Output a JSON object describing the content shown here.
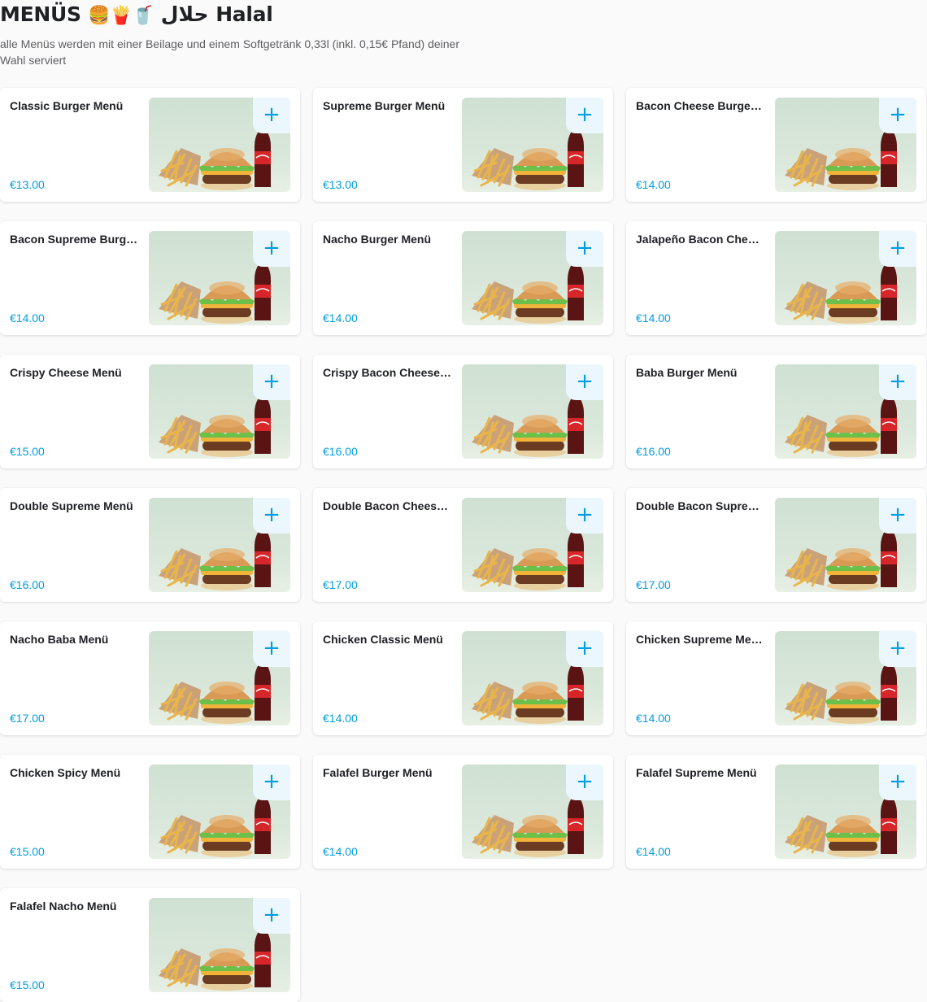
{
  "section": {
    "title": "MENÜS",
    "emoji": "🍔🍟🥤",
    "title_suffix": "حلال Halal",
    "description": "alle Menüs werden mit einer Beilage und einem Softgetränk 0,33l (inkl. 0,15€ Pfand) deiner Wahl serviert"
  },
  "add_label": "+",
  "colors": {
    "accent": "#009de0",
    "add_bg": "#ebf7fd",
    "image_bg": "#d4e5d7"
  },
  "items": [
    {
      "name": "Classic Burger Menü",
      "price": "€13.00"
    },
    {
      "name": "Supreme Burger Menü",
      "price": "€13.00"
    },
    {
      "name": "Bacon Cheese Burger Menü",
      "price": "€14.00"
    },
    {
      "name": "Bacon Supreme Burger Menü",
      "price": "€14.00"
    },
    {
      "name": "Nacho Burger Menü",
      "price": "€14.00"
    },
    {
      "name": "Jalapeño Bacon Cheese Menü",
      "price": "€14.00"
    },
    {
      "name": "Crispy Cheese Menü",
      "price": "€15.00"
    },
    {
      "name": "Crispy Bacon Cheese Menü",
      "price": "€16.00"
    },
    {
      "name": "Baba Burger Menü",
      "price": "€16.00"
    },
    {
      "name": "Double Supreme Menü",
      "price": "€16.00"
    },
    {
      "name": "Double Bacon Cheese Menü",
      "price": "€17.00"
    },
    {
      "name": "Double Bacon Supreme Menü",
      "price": "€17.00"
    },
    {
      "name": "Nacho Baba Menü",
      "price": "€17.00"
    },
    {
      "name": "Chicken Classic Menü",
      "price": "€14.00"
    },
    {
      "name": "Chicken Supreme Menü",
      "price": "€14.00"
    },
    {
      "name": "Chicken Spicy Menü",
      "price": "€15.00"
    },
    {
      "name": "Falafel Burger Menü",
      "price": "€14.00"
    },
    {
      "name": "Falafel Supreme Menü",
      "price": "€14.00"
    },
    {
      "name": "Falafel Nacho Menü",
      "price": "€15.00"
    }
  ]
}
